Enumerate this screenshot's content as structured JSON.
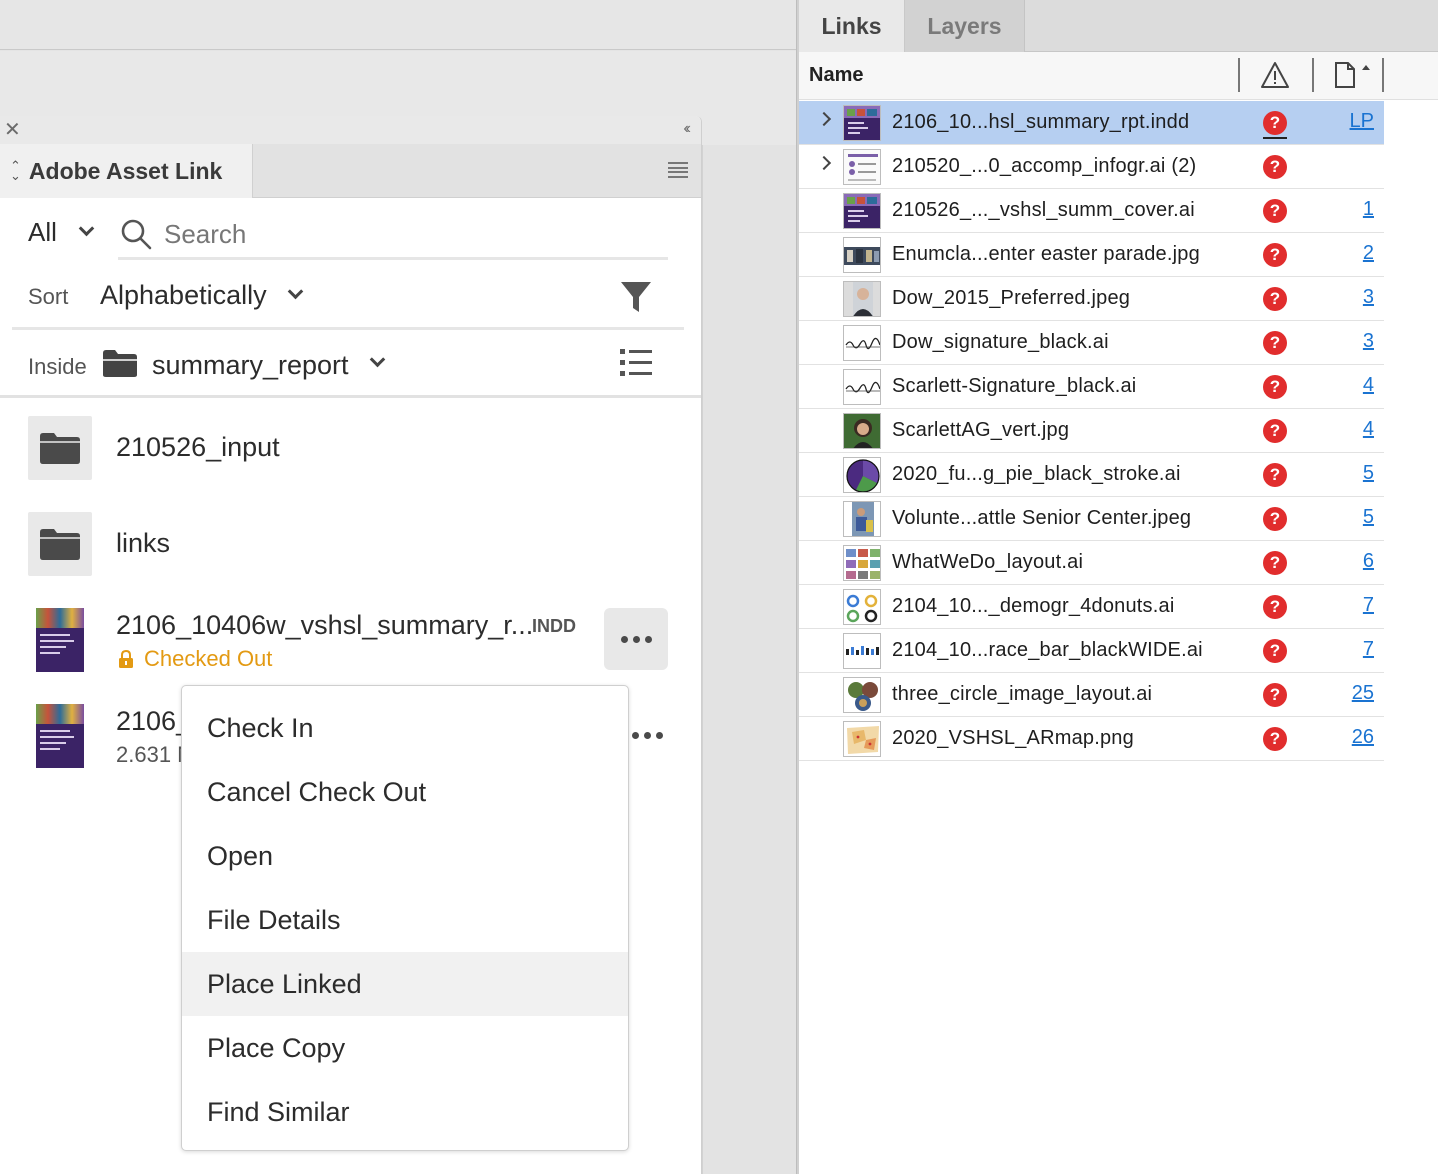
{
  "asset_link": {
    "tab_title": "Adobe Asset Link",
    "filter": {
      "value": "All"
    },
    "search": {
      "placeholder": "Search"
    },
    "sort": {
      "label": "Sort",
      "value": "Alphabetically"
    },
    "inside": {
      "label": "Inside",
      "value": "summary_report"
    },
    "folders": [
      {
        "name": "210526_input"
      },
      {
        "name": "links"
      }
    ],
    "files": [
      {
        "name": "2106_10406w_vshsl_summary_r...",
        "type": "INDD",
        "status": "Checked Out"
      },
      {
        "name": "2106_",
        "size": "2.631 M"
      }
    ]
  },
  "context_menu": {
    "items": [
      "Check In",
      "Cancel Check Out",
      "Open",
      "File Details",
      "Place Linked",
      "Place Copy",
      "Find Similar"
    ],
    "hovered": "Place Linked"
  },
  "links_panel": {
    "tabs": [
      "Links",
      "Layers"
    ],
    "header": {
      "name": "Name"
    },
    "rows": [
      {
        "name": "2106_10...hsl_summary_rpt.indd",
        "page": "LP",
        "expandable": true,
        "selected": true,
        "thumb": "indd-cover"
      },
      {
        "name": "210520_...0_accomp_infogr.ai (2)",
        "page": "",
        "expandable": true,
        "thumb": "infographic"
      },
      {
        "name": "210526_..._vshsl_summ_cover.ai",
        "page": "1",
        "thumb": "indd-cover"
      },
      {
        "name": "Enumcla...enter easter parade.jpg",
        "page": "2",
        "thumb": "photo-parade"
      },
      {
        "name": "Dow_2015_Preferred.jpeg",
        "page": "3",
        "thumb": "photo-portrait-man"
      },
      {
        "name": "Dow_signature_black.ai",
        "page": "3",
        "thumb": "signature"
      },
      {
        "name": "Scarlett-Signature_black.ai",
        "page": "4",
        "thumb": "signature"
      },
      {
        "name": "ScarlettAG_vert.jpg",
        "page": "4",
        "thumb": "photo-portrait-woman"
      },
      {
        "name": "2020_fu...g_pie_black_stroke.ai",
        "page": "5",
        "thumb": "pie-chart"
      },
      {
        "name": "Volunte...attle Senior Center.jpeg",
        "page": "5",
        "thumb": "photo-volunteer"
      },
      {
        "name": "WhatWeDo_layout.ai",
        "page": "6",
        "thumb": "layout"
      },
      {
        "name": "2104_10..._demogr_4donuts.ai",
        "page": "7",
        "thumb": "donuts"
      },
      {
        "name": "2104_10...race_bar_blackWIDE.ai",
        "page": "7",
        "thumb": "bar"
      },
      {
        "name": "three_circle_image_layout.ai",
        "page": "25",
        "thumb": "circles"
      },
      {
        "name": "2020_VSHSL_ARmap.png",
        "page": "26",
        "thumb": "map"
      }
    ]
  },
  "colors": {
    "accent_blue": "#1a73d1",
    "selection": "#b6cff1",
    "checked_out": "#e39a13",
    "warning_red": "#e12d2d"
  }
}
